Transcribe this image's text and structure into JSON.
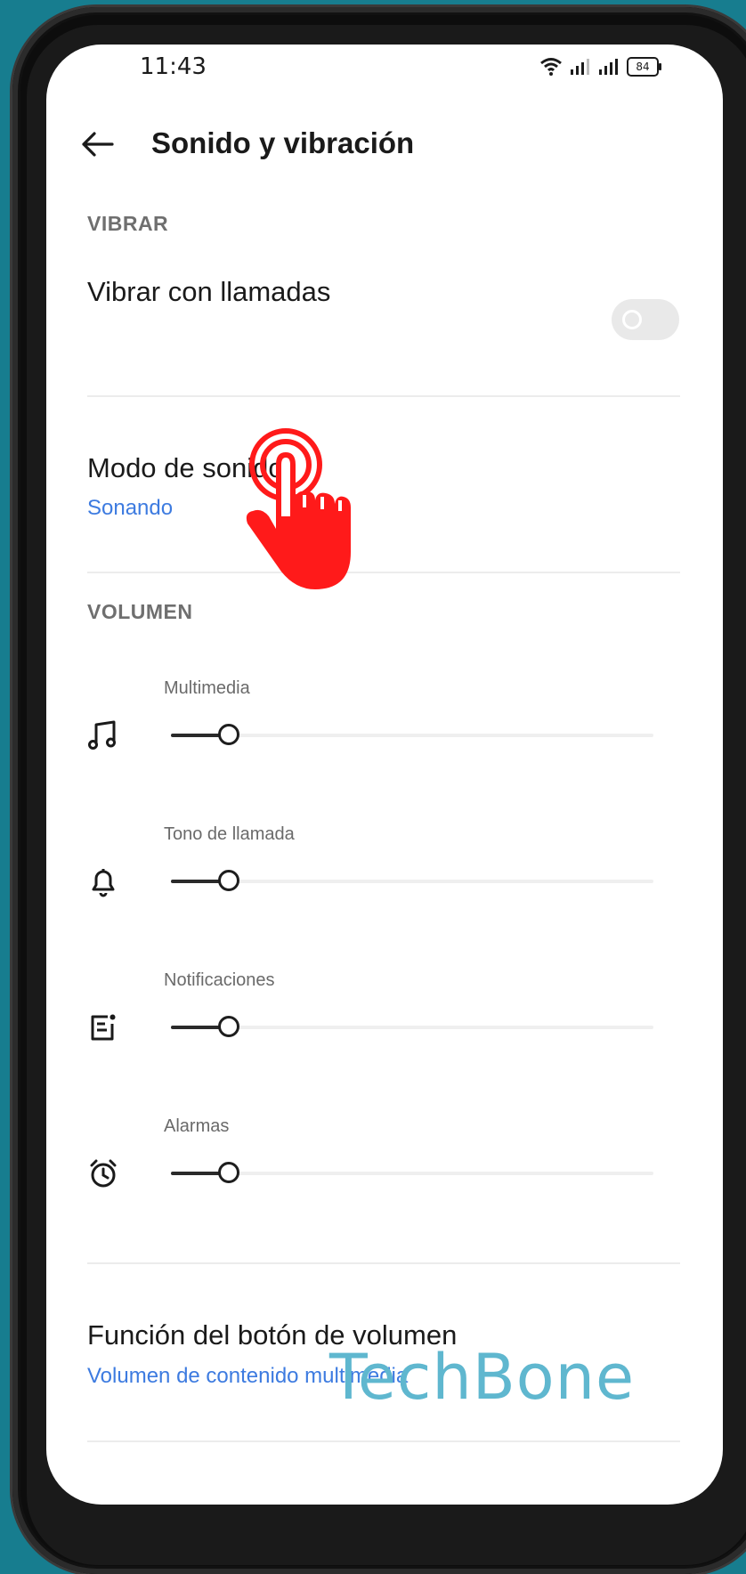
{
  "status_bar": {
    "time": "11:43",
    "battery": "84"
  },
  "header": {
    "title": "Sonido y vibración"
  },
  "sections": {
    "vibrate": {
      "header": "VIBRAR",
      "row_label": "Vibrar con llamadas",
      "toggle_on": false
    },
    "sound_mode": {
      "title": "Modo de sonido",
      "value": "Sonando"
    },
    "volume": {
      "header": "VOLUMEN",
      "sliders": [
        {
          "label": "Multimedia",
          "icon": "music-note-icon",
          "level": 0.12
        },
        {
          "label": "Tono de llamada",
          "icon": "bell-icon",
          "level": 0.12
        },
        {
          "label": "Notificaciones",
          "icon": "notification-icon",
          "level": 0.12
        },
        {
          "label": "Alarmas",
          "icon": "alarm-clock-icon",
          "level": 0.12
        }
      ]
    },
    "volume_button": {
      "title": "Función del botón de volumen",
      "value": "Volumen de contenido multimedia"
    }
  },
  "watermark": "TechBone",
  "colors": {
    "background": "#177d8f",
    "accent": "#3d7be0",
    "tap_indicator": "#ff1a1a"
  }
}
